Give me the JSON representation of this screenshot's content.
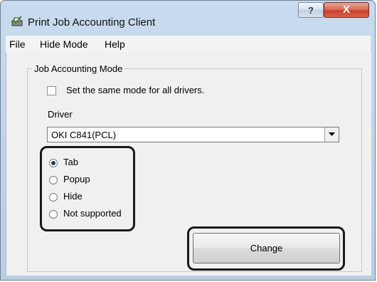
{
  "window": {
    "title": "Print Job Accounting Client",
    "help_button": "?",
    "close_button": "X"
  },
  "menu": {
    "items": [
      "File",
      "Hide Mode",
      "Help"
    ]
  },
  "group": {
    "label": "Job Accounting Mode",
    "same_mode_checkbox": {
      "label": "Set the same mode for all drivers.",
      "checked": false
    },
    "driver_label": "Driver",
    "driver_value": "OKI C841(PCL)",
    "radios": [
      {
        "label": "Tab",
        "checked": true
      },
      {
        "label": "Popup",
        "checked": false
      },
      {
        "label": "Hide",
        "checked": false
      },
      {
        "label": "Not supported",
        "checked": false
      }
    ],
    "change_button": "Change"
  }
}
